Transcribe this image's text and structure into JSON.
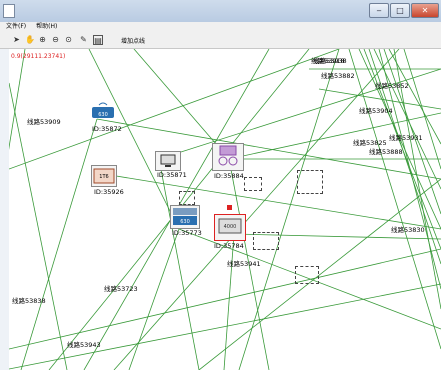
{
  "menu": {
    "file": "文件(F)",
    "help": "帮助(H)"
  },
  "toolbar": {
    "add_label": "增加点线"
  },
  "canvas": {
    "coordinate": "0.9(29111.23741)",
    "line_labels": [
      "线路53909",
      "线路53938",
      "线路53852",
      "线路53904",
      "线路53931",
      "线路53825",
      "线路53888",
      "线路53830",
      "线路53941",
      "线路53723",
      "线路53838",
      "线路53943",
      "线路53918",
      "线路53882"
    ],
    "nodes": [
      {
        "id": "ID:35872",
        "icon": "router-icon"
      },
      {
        "id": "ID:35871",
        "icon": "monitor-icon"
      },
      {
        "id": "ID:35884",
        "icon": "camera-icon"
      },
      {
        "id": "ID:35926",
        "icon": "switch-icon"
      },
      {
        "id": "ID:35773",
        "icon": "device-icon"
      },
      {
        "id": "ID:35784",
        "icon": "server-icon"
      }
    ]
  }
}
